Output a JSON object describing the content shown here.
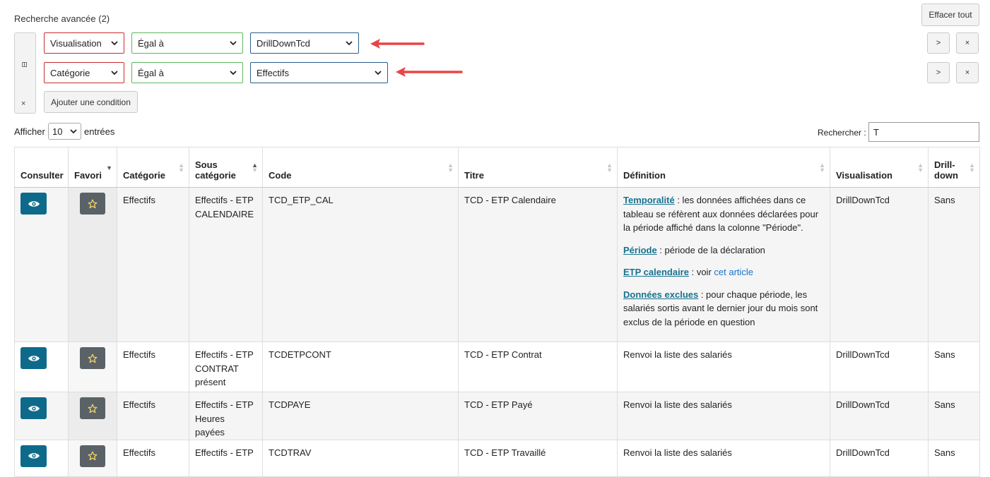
{
  "header": {
    "title": "Recherche avancée (2)",
    "clear_all": "Effacer tout"
  },
  "filters": [
    {
      "field": "Visualisation",
      "operator": "Égal à",
      "value": "DrillDownTcd"
    },
    {
      "field": "Catégorie",
      "operator": "Égal à",
      "value": "Effectifs"
    }
  ],
  "filter_buttons": {
    "next": ">",
    "remove": "×",
    "group_icon": "⊟",
    "group_remove": "×"
  },
  "add_condition": "Ajouter une condition",
  "length": {
    "show": "Afficher",
    "value": "10",
    "entries": "entrées"
  },
  "search": {
    "label": "Rechercher :",
    "value": "T"
  },
  "columns": [
    "Consulter",
    "Favori",
    "Catégorie",
    "Sous catégorie",
    "Code",
    "Titre",
    "Définition",
    "Visualisation",
    "Drill-down"
  ],
  "rows": [
    {
      "categorie": "Effectifs",
      "sous_categorie": "Effectifs - ETP CALENDAIRE",
      "code": "TCD_ETP_CAL",
      "titre": "TCD - ETP Calendaire",
      "definition": {
        "p1_term": "Temporalité",
        "p1_text": " : les données affichées dans ce tableau se réfèrent aux données déclarées pour la période affiché dans la colonne \"Période\".",
        "p2_term": "Période",
        "p2_text": " : période de la déclaration",
        "p3_term": "ETP calendaire",
        "p3_text": " : voir ",
        "p3_link": "cet article",
        "p4_term": "Données exclues",
        "p4_text": " : pour chaque période, les salariés sortis avant le dernier jour du mois sont exclus de la période en question"
      },
      "visualisation": "DrillDownTcd",
      "drilldown": "Sans"
    },
    {
      "categorie": "Effectifs",
      "sous_categorie": "Effectifs - ETP CONTRAT présent",
      "code": "TCDETPCONT",
      "titre": "TCD - ETP Contrat",
      "definition_text": "Renvoi la liste des salariés",
      "visualisation": "DrillDownTcd",
      "drilldown": "Sans"
    },
    {
      "categorie": "Effectifs",
      "sous_categorie": "Effectifs - ETP Heures payées",
      "code": "TCDPAYE",
      "titre": "TCD - ETP Payé",
      "definition_text": "Renvoi la liste des salariés",
      "visualisation": "DrillDownTcd",
      "drilldown": "Sans"
    },
    {
      "categorie": "Effectifs",
      "sous_categorie": "Effectifs - ETP",
      "code": "TCDTRAV",
      "titre": "TCD - ETP Travaillé",
      "definition_text": "Renvoi la liste des salariés",
      "visualisation": "DrillDownTcd",
      "drilldown": "Sans"
    }
  ],
  "colors": {
    "annotation_arrow": "#e84545",
    "eye_button": "#0e6a8a",
    "star_button": "#5a6268",
    "star": "#f0d264"
  }
}
